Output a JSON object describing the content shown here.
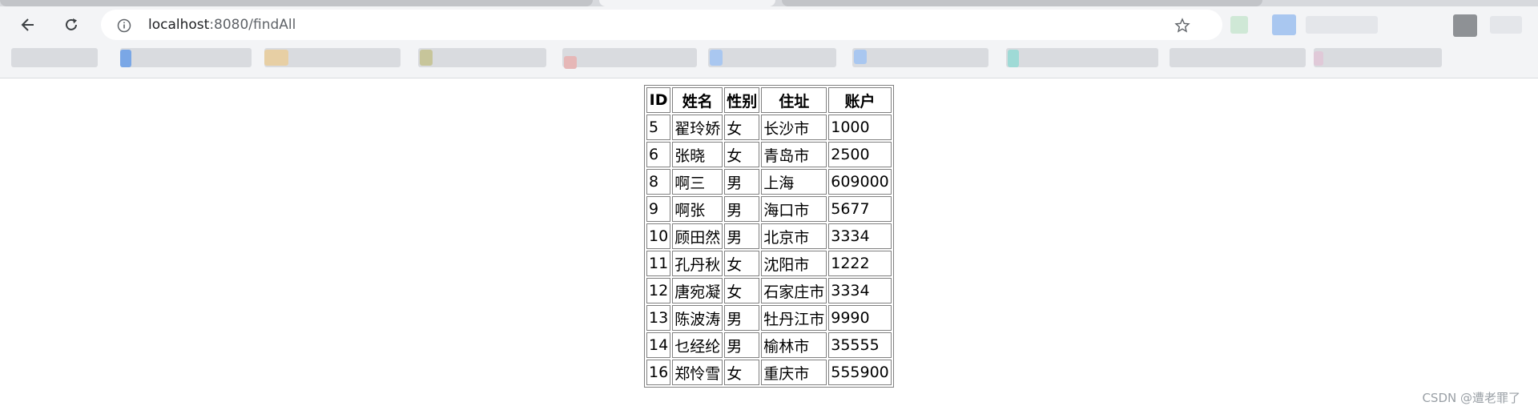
{
  "browser": {
    "url_host": "localhost",
    "url_rest": ":8080/findAll"
  },
  "table": {
    "headers": [
      "ID",
      "姓名",
      "性别",
      "住址",
      "账户"
    ],
    "rows": [
      [
        "5",
        "翟玲娇",
        "女",
        "长沙市",
        "1000"
      ],
      [
        "6",
        "张晓",
        "女",
        "青岛市",
        "2500"
      ],
      [
        "8",
        "啊三",
        "男",
        "上海",
        "609000"
      ],
      [
        "9",
        "啊张",
        "男",
        "海口市",
        "5677"
      ],
      [
        "10",
        "顾田然",
        "男",
        "北京市",
        "3334"
      ],
      [
        "11",
        "孔丹秋",
        "女",
        "沈阳市",
        "1222"
      ],
      [
        "12",
        "唐宛凝",
        "女",
        "石家庄市",
        "3334"
      ],
      [
        "13",
        "陈波涛",
        "男",
        "牡丹江市",
        "9990"
      ],
      [
        "14",
        "乜经纶",
        "男",
        "榆林市",
        "35555"
      ],
      [
        "16",
        "郑怜雪",
        "女",
        "重庆市",
        "555900"
      ]
    ]
  },
  "watermark": "CSDN @遭老罪了"
}
